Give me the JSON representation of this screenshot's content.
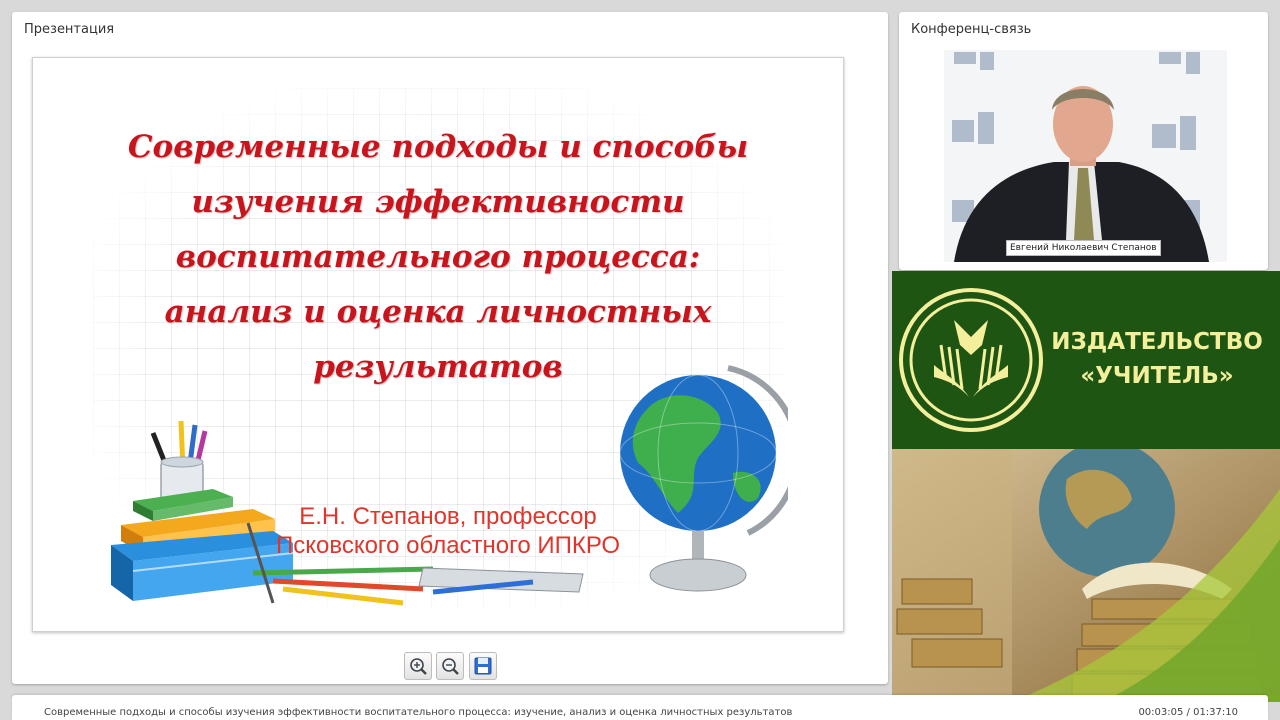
{
  "presentation": {
    "title": "Презентация",
    "slide": {
      "title_lines": [
        "Современные подходы и способы",
        "изучения эффективности",
        "воспитательного процесса:",
        "анализ и оценка личностных",
        "результатов"
      ],
      "author_lines": [
        "Е.Н. Степанов, профессор",
        "Псковского областного ИПКРО"
      ]
    },
    "toolbar": {
      "zoom_in_icon": "zoom-in-icon",
      "zoom_out_icon": "zoom-out-icon",
      "save_icon": "floppy-disk-icon"
    }
  },
  "conference": {
    "title": "Конференц-связь",
    "speaker_name": "Евгений Николаевич Степанов"
  },
  "publisher": {
    "line1": "ИЗДАТЕЛЬСТВО",
    "line2": "«УЧИТЕЛЬ»",
    "color_bg": "#1f5512",
    "color_text": "#f3ef9c"
  },
  "bottom_bar": {
    "title": "Современные подходы и способы изучения эффективности воспитательного процесса: изучение, анализ и оценка личностных результатов",
    "time": "00:03:05 / 01:37:10"
  }
}
